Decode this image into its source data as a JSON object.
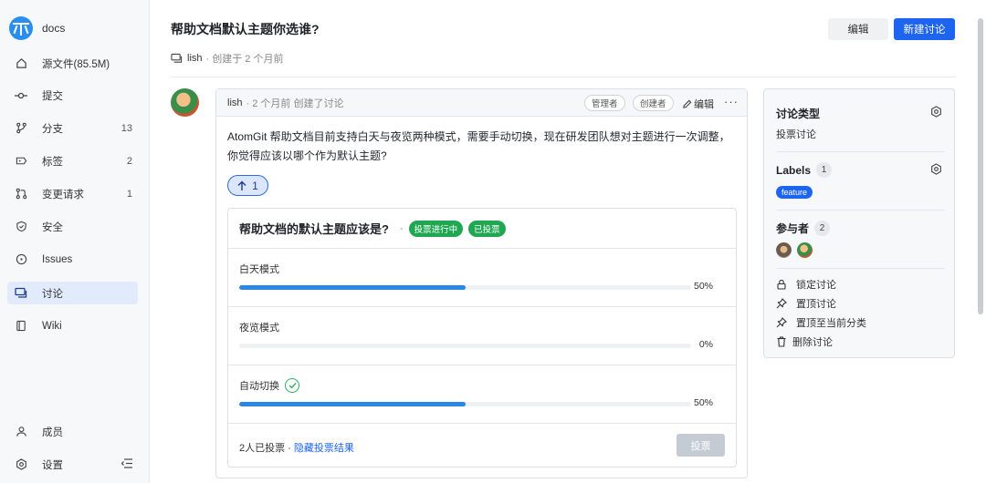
{
  "sidebar": {
    "repo_name": "docs",
    "items": [
      {
        "label": "源文件(85.5M)",
        "count": ""
      },
      {
        "label": "提交",
        "count": ""
      },
      {
        "label": "分支",
        "count": "13"
      },
      {
        "label": "标签",
        "count": "2"
      },
      {
        "label": "变更请求",
        "count": "1"
      },
      {
        "label": "安全",
        "count": ""
      },
      {
        "label": "Issues",
        "count": ""
      },
      {
        "label": "讨论",
        "count": ""
      },
      {
        "label": "Wiki",
        "count": ""
      }
    ],
    "bottom": [
      {
        "label": "成员"
      },
      {
        "label": "设置"
      }
    ]
  },
  "header": {
    "title": "帮助文档默认主题你选谁?",
    "author": "lish",
    "created": "· 创建于 2 个月前",
    "edit_label": "编辑",
    "new_label": "新建讨论"
  },
  "post": {
    "author": "lish",
    "time": "· 2 个月前 创建了讨论",
    "tag_admin": "管理者",
    "tag_creator": "创建者",
    "edit": "编辑",
    "more": "···",
    "body": "AtomGit 帮助文档目前支持白天与夜览两种模式，需要手动切换，现在研发团队想对主题进行一次调整，你觉得应该以哪个作为默认主题?",
    "upvotes": "1"
  },
  "poll": {
    "title": "帮助文档的默认主题应该是?",
    "dot": "·",
    "status": "投票进行中",
    "voted": "已投票",
    "options": [
      {
        "label": "白天模式",
        "percent": 50,
        "percent_text": "50%"
      },
      {
        "label": "夜览模式",
        "percent": 0,
        "percent_text": "0%"
      },
      {
        "label": "自动切换",
        "percent": 50,
        "percent_text": "50%",
        "selected": true
      }
    ],
    "footer_count": "2人已投票 ·",
    "footer_link": "隐藏投票结果",
    "vote_button": "投票"
  },
  "panel": {
    "type_title": "讨论类型",
    "type_value": "投票讨论",
    "labels_title": "Labels",
    "labels_count": "1",
    "label_chip": "feature",
    "participants_title": "参与者",
    "participants_count": "2",
    "actions": [
      "锁定讨论",
      "置顶讨论",
      "置顶至当前分类",
      "删除讨论"
    ]
  },
  "colors": {
    "accent": "#1d64f0",
    "green": "#1fa851",
    "progress": "#2a87e8"
  }
}
